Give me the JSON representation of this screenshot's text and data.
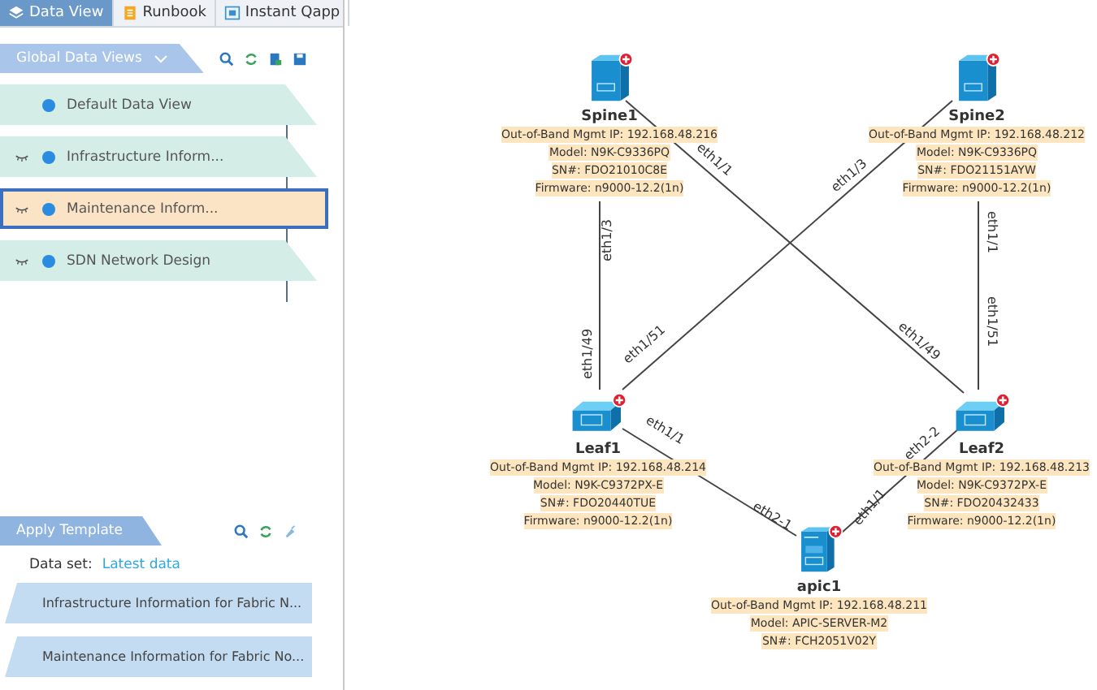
{
  "tabs": [
    {
      "label": "Data View",
      "selected": true
    },
    {
      "label": "Runbook",
      "selected": false
    },
    {
      "label": "Instant Qapp",
      "selected": false
    }
  ],
  "data_views": {
    "title": "Global Data Views",
    "items": [
      {
        "label": "Default Data View",
        "hidden": false,
        "selected": false
      },
      {
        "label": "Infrastructure Inform...",
        "hidden": true,
        "selected": false
      },
      {
        "label": "Maintenance Inform...",
        "hidden": true,
        "selected": true
      },
      {
        "label": "SDN Network Design",
        "hidden": true,
        "selected": false
      }
    ]
  },
  "apply_template": {
    "title": "Apply Template",
    "data_set_label": "Data set:",
    "data_set_value": "Latest data",
    "items": [
      "Infrastructure Information for Fabric N...",
      "Maintenance Information for Fabric No..."
    ]
  },
  "diagram": {
    "nodes": [
      {
        "name": "Spine1",
        "kind": "spine",
        "info": [
          "Out-of-Band Mgmt IP: 192.168.48.216",
          "Model: N9K-C9336PQ",
          "SN#: FDO21010C8E",
          "Firmware: n9000-12.2(1n)"
        ]
      },
      {
        "name": "Spine2",
        "kind": "spine",
        "info": [
          "Out-of-Band Mgmt IP: 192.168.48.212",
          "Model: N9K-C9336PQ",
          "SN#: FDO21151AYW",
          "Firmware: n9000-12.2(1n)"
        ]
      },
      {
        "name": "Leaf1",
        "kind": "leaf",
        "info": [
          "Out-of-Band Mgmt IP: 192.168.48.214",
          "Model: N9K-C9372PX-E",
          "SN#: FDO20440TUE",
          "Firmware: n9000-12.2(1n)"
        ]
      },
      {
        "name": "Leaf2",
        "kind": "leaf",
        "info": [
          "Out-of-Band Mgmt IP: 192.168.48.213",
          "Model: N9K-C9372PX-E",
          "SN#: FDO20432433",
          "Firmware: n9000-12.2(1n)"
        ]
      },
      {
        "name": "apic1",
        "kind": "apic",
        "info": [
          "Out-of-Band Mgmt IP: 192.168.48.211",
          "Model: APIC-SERVER-M2",
          "SN#: FCH2051V02Y"
        ]
      }
    ],
    "links": [
      {
        "from_port": "eth1/3",
        "to_port": "eth1/49"
      },
      {
        "from_port": "eth1/1",
        "to_port": "eth1/49"
      },
      {
        "from_port": "eth1/3",
        "to_port": "eth1/51"
      },
      {
        "from_port": "eth1/1",
        "to_port": "eth1/51"
      },
      {
        "from_port": "eth1/1",
        "to_port": "eth2-1"
      },
      {
        "from_port": "eth2-2",
        "to_port": "eth1/1"
      }
    ]
  }
}
